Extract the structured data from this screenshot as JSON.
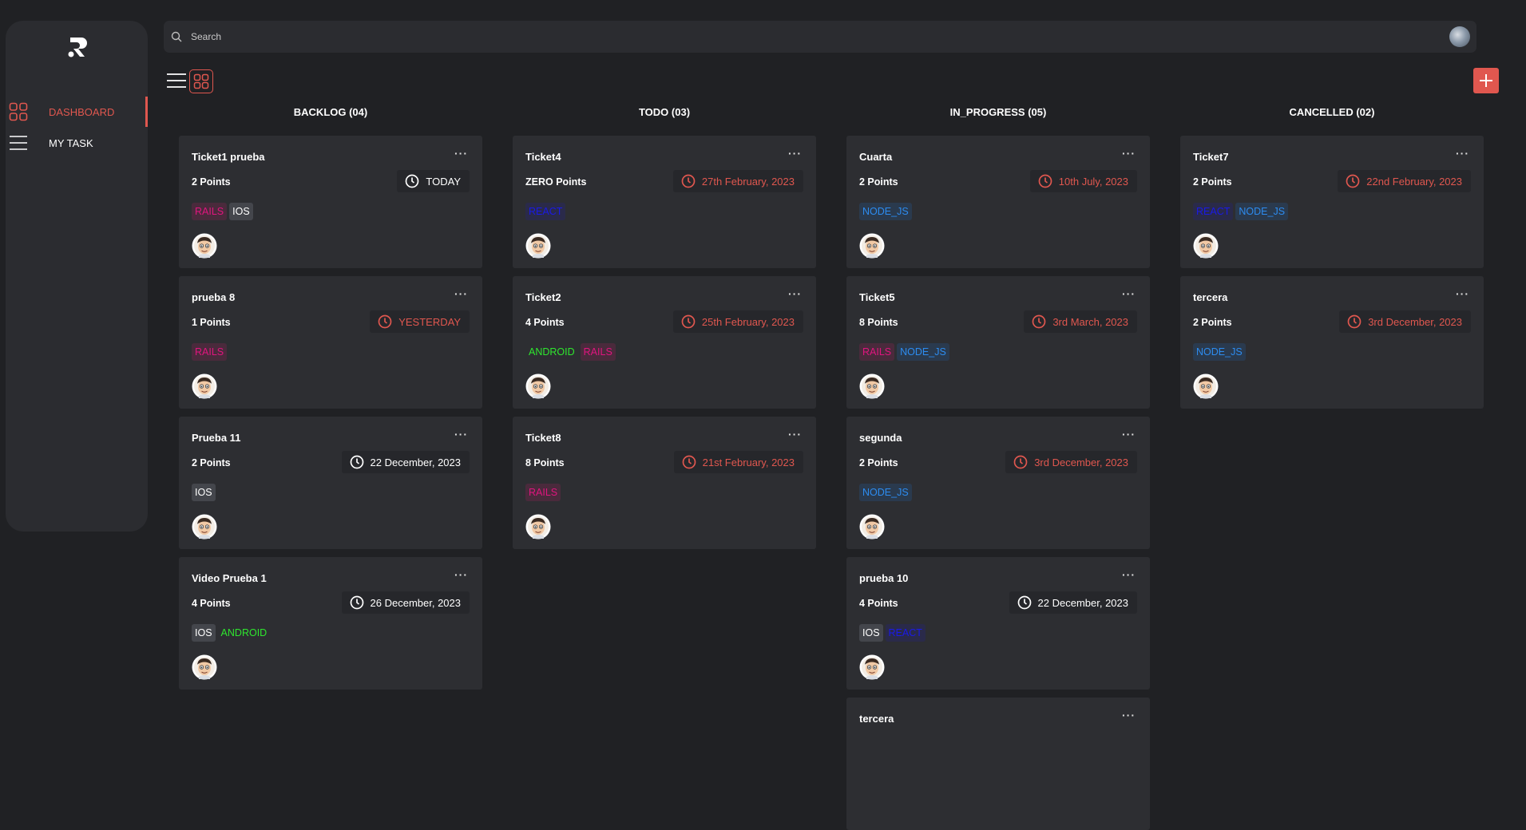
{
  "app": {
    "logo": "R-logo",
    "accent": "#e0574f"
  },
  "sidebar": {
    "items": [
      {
        "label": "DASHBOARD",
        "icon": "grid-icon",
        "active": true
      },
      {
        "label": "MY TASK",
        "icon": "menu-icon",
        "active": false
      }
    ]
  },
  "search": {
    "placeholder": "Search",
    "value": ""
  },
  "toolbar": {
    "list_view_icon": "menu-icon",
    "grid_view_icon": "grid-icon",
    "add_icon": "plus-icon"
  },
  "tag_colors": {
    "RAILS": {
      "fg": "#e0157f",
      "bg": "#4a2a3c"
    },
    "IOS": {
      "fg": "#ffffff",
      "bg": "#44464c"
    },
    "REACT": {
      "fg": "#1a1ae6",
      "bg": "#2a2a4a"
    },
    "NODE_JS": {
      "fg": "#2d8cf0",
      "bg": "#2a3a4e"
    },
    "ANDROID": {
      "fg": "#2ee62e",
      "bg": "#2d2e32"
    }
  },
  "columns": [
    {
      "title": "BACKLOG (04)",
      "cards": [
        {
          "title": "Ticket1 prueba",
          "points": "2 Points",
          "date": "TODAY",
          "date_color": "white",
          "tags": [
            "RAILS",
            "IOS"
          ]
        },
        {
          "title": "prueba 8",
          "points": "1 Points",
          "date": "YESTERDAY",
          "date_color": "red",
          "tags": [
            "RAILS"
          ]
        },
        {
          "title": "Prueba 11",
          "points": "2 Points",
          "date": "22 December, 2023",
          "date_color": "white",
          "tags": [
            "IOS"
          ]
        },
        {
          "title": "Video Prueba 1",
          "points": "4 Points",
          "date": "26 December, 2023",
          "date_color": "white",
          "tags": [
            "IOS",
            "ANDROID"
          ]
        }
      ]
    },
    {
      "title": "TODO (03)",
      "cards": [
        {
          "title": "Ticket4",
          "points": "ZERO Points",
          "date": "27th February, 2023",
          "date_color": "red",
          "tags": [
            "REACT"
          ]
        },
        {
          "title": "Ticket2",
          "points": "4 Points",
          "date": "25th February, 2023",
          "date_color": "red",
          "tags": [
            "ANDROID",
            "RAILS"
          ]
        },
        {
          "title": "Ticket8",
          "points": "8 Points",
          "date": "21st February, 2023",
          "date_color": "red",
          "tags": [
            "RAILS"
          ]
        }
      ]
    },
    {
      "title": "IN_PROGRESS (05)",
      "cards": [
        {
          "title": "Cuarta",
          "points": "2 Points",
          "date": "10th July, 2023",
          "date_color": "red",
          "tags": [
            "NODE_JS"
          ]
        },
        {
          "title": "Ticket5",
          "points": "8 Points",
          "date": "3rd March, 2023",
          "date_color": "red",
          "tags": [
            "RAILS",
            "NODE_JS"
          ]
        },
        {
          "title": "segunda",
          "points": "2 Points",
          "date": "3rd December, 2023",
          "date_color": "red",
          "tags": [
            "NODE_JS"
          ]
        },
        {
          "title": "prueba 10",
          "points": "4 Points",
          "date": "22 December, 2023",
          "date_color": "white",
          "tags": [
            "IOS",
            "REACT"
          ]
        },
        {
          "title": "tercera",
          "points": "",
          "date": "",
          "date_color": "",
          "tags": []
        }
      ]
    },
    {
      "title": "CANCELLED (02)",
      "cards": [
        {
          "title": "Ticket7",
          "points": "2 Points",
          "date": "22nd February, 2023",
          "date_color": "red",
          "tags": [
            "REACT",
            "NODE_JS"
          ]
        },
        {
          "title": "tercera",
          "points": "2 Points",
          "date": "3rd December, 2023",
          "date_color": "red",
          "tags": [
            "NODE_JS"
          ]
        }
      ]
    }
  ],
  "card_menu_label": "···"
}
